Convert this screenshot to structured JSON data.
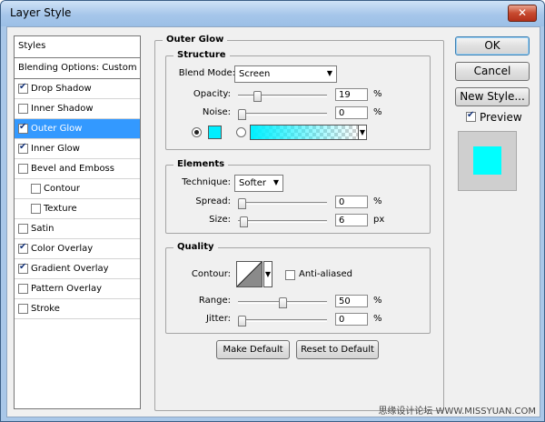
{
  "window": {
    "title": "Layer Style",
    "close_glyph": "✕"
  },
  "styles_list": {
    "header": "Styles",
    "blending": "Blending Options: Custom",
    "items": [
      {
        "label": "Drop Shadow",
        "checked": true,
        "indent": false,
        "selected": false
      },
      {
        "label": "Inner Shadow",
        "checked": false,
        "indent": false,
        "selected": false
      },
      {
        "label": "Outer Glow",
        "checked": true,
        "indent": false,
        "selected": true
      },
      {
        "label": "Inner Glow",
        "checked": true,
        "indent": false,
        "selected": false
      },
      {
        "label": "Bevel and Emboss",
        "checked": false,
        "indent": false,
        "selected": false
      },
      {
        "label": "Contour",
        "checked": false,
        "indent": true,
        "selected": false
      },
      {
        "label": "Texture",
        "checked": false,
        "indent": true,
        "selected": false
      },
      {
        "label": "Satin",
        "checked": false,
        "indent": false,
        "selected": false
      },
      {
        "label": "Color Overlay",
        "checked": true,
        "indent": false,
        "selected": false
      },
      {
        "label": "Gradient Overlay",
        "checked": true,
        "indent": false,
        "selected": false
      },
      {
        "label": "Pattern Overlay",
        "checked": false,
        "indent": false,
        "selected": false
      },
      {
        "label": "Stroke",
        "checked": false,
        "indent": false,
        "selected": false
      }
    ]
  },
  "outer_glow": {
    "title": "Outer Glow",
    "structure": {
      "title": "Structure",
      "blend_mode_label": "Blend Mode:",
      "blend_mode_value": "Screen",
      "opacity_label": "Opacity:",
      "opacity_value": "19",
      "opacity_unit": "%",
      "opacity_fraction": 0.19,
      "noise_label": "Noise:",
      "noise_value": "0",
      "noise_unit": "%",
      "noise_fraction": 0,
      "glow_color": "#00eeff"
    },
    "elements": {
      "title": "Elements",
      "technique_label": "Technique:",
      "technique_value": "Softer",
      "spread_label": "Spread:",
      "spread_value": "0",
      "spread_unit": "%",
      "spread_fraction": 0,
      "size_label": "Size:",
      "size_value": "6",
      "size_unit": "px",
      "size_fraction": 0.024
    },
    "quality": {
      "title": "Quality",
      "contour_label": "Contour:",
      "anti_aliased_label": "Anti-aliased",
      "anti_aliased": false,
      "range_label": "Range:",
      "range_value": "50",
      "range_unit": "%",
      "range_fraction": 0.5,
      "jitter_label": "Jitter:",
      "jitter_value": "0",
      "jitter_unit": "%",
      "jitter_fraction": 0
    },
    "make_default": "Make Default",
    "reset_default": "Reset to Default"
  },
  "buttons": {
    "ok": "OK",
    "cancel": "Cancel",
    "new_style": "New Style..."
  },
  "preview": {
    "label": "Preview",
    "checked": true,
    "swatch_color": "#00ffff"
  },
  "watermark": "思缘设计论坛 WWW.MISSYUAN.COM"
}
